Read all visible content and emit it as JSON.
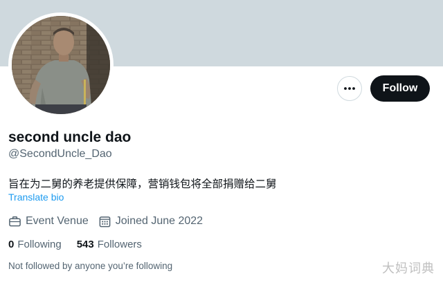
{
  "profile": {
    "display_name": "second uncle dao",
    "handle": "@SecondUncle_Dao",
    "bio": "旨在为二舅的养老提供保障，营销钱包将全部捐赠给二舅",
    "translate_bio_label": "Translate bio",
    "location": "Event Venue",
    "joined": "Joined June 2022",
    "following_count": "0",
    "following_label": "Following",
    "followers_count": "543",
    "followers_label": "Followers",
    "not_followed_text": "Not followed by anyone you’re following"
  },
  "actions": {
    "more_icon": "more-horizontal-icon",
    "follow_label": "Follow"
  },
  "icons": {
    "location": "briefcase-icon",
    "joined": "calendar-icon"
  },
  "watermark": "大妈词典",
  "colors": {
    "banner": "#cfd9de",
    "follow_button_bg": "#0f1419",
    "link": "#1d9bf0",
    "secondary_text": "#536471",
    "primary_text": "#0f1419"
  }
}
